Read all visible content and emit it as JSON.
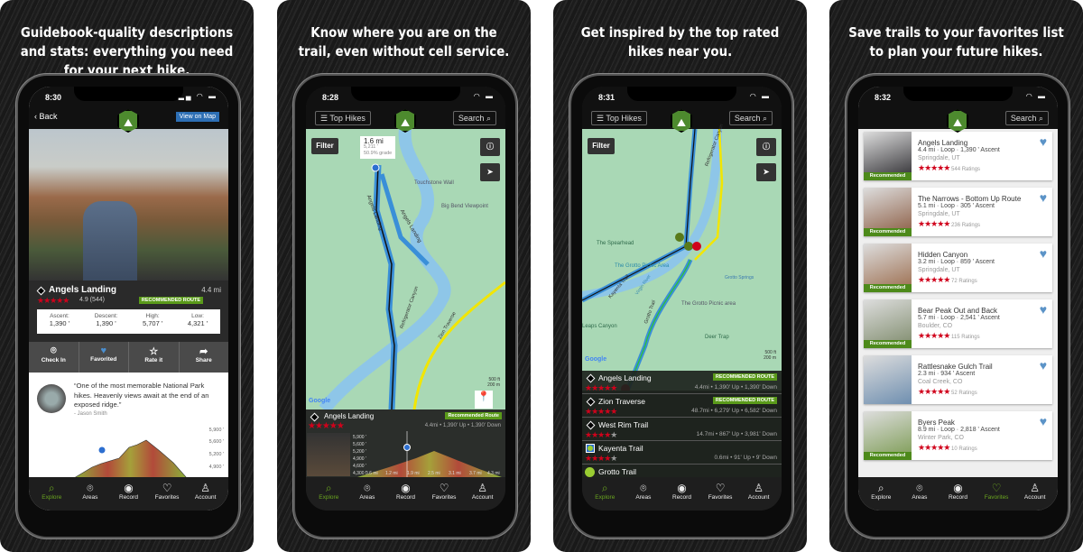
{
  "captions": [
    "Guidebook-quality descriptions and stats: everything you need for your next hike.",
    "Know where you are on the trail, even without cell service.",
    "Get inspired by the top rated hikes near you.",
    "Save trails to your favorites list to plan your future hikes."
  ],
  "status_times": [
    "8:30",
    "8:28",
    "8:31",
    "8:32"
  ],
  "tabs": [
    {
      "label": "Explore",
      "icon": "search"
    },
    {
      "label": "Areas",
      "icon": "pin"
    },
    {
      "label": "Record",
      "icon": "record"
    },
    {
      "label": "Favorites",
      "icon": "heart"
    },
    {
      "label": "Account",
      "icon": "person"
    }
  ],
  "screen1": {
    "back": "Back",
    "view_map": "View on Map",
    "title": "Angels Landing",
    "distance": "4.4 mi",
    "rating": "4.9 (544)",
    "badge": "RECOMMENDED ROUTE",
    "stats": [
      {
        "label": "Ascent:",
        "value": "1,390 '"
      },
      {
        "label": "Descent:",
        "value": "1,390 '"
      },
      {
        "label": "High:",
        "value": "5,707 '"
      },
      {
        "label": "Low:",
        "value": "4,321 '"
      }
    ],
    "actions": [
      {
        "label": "Check In",
        "icon": "pin"
      },
      {
        "label": "Favorited",
        "icon": "heart-filled"
      },
      {
        "label": "Rate it",
        "icon": "star"
      },
      {
        "label": "Share",
        "icon": "share"
      }
    ],
    "quote": "“One of the most memorable National Park hikes. Heavenly views await at the end of an exposed ridge.”",
    "author": "- Jason Smith",
    "elev_ticks": [
      "5,900 '",
      "5,600 '",
      "5,200 '",
      "4,900 '"
    ]
  },
  "screen2": {
    "top_hikes": "Top Hikes",
    "search": "Search",
    "filter": "Filter",
    "tooltip": {
      "dist": "1.6 mi",
      "elev": "5,211 '",
      "grade": "50.9% grade"
    },
    "map_labels": [
      "Touchstone Wall",
      "Big Bend Viewpoint",
      "Angels Landing",
      "Angels Landing",
      "Refrigerator Canyon",
      "Zion Traverse"
    ],
    "scale": [
      "500 ft",
      "200 m"
    ],
    "google": "Google",
    "sheet": {
      "title": "Angels Landing",
      "badge": "Recommended Route",
      "stats": "4.4mi • 1,390' Up • 1,390' Down",
      "y_ticks": [
        "5,900 '",
        "5,600 '",
        "5,200 '",
        "4,900 '",
        "4,600 '",
        "4,300 '"
      ],
      "x_ticks": [
        "0.6 mi",
        "1.2 mi",
        "1.9 mi",
        "2.5 mi",
        "3.1 mi",
        "3.7 mi",
        "4.3 mi"
      ]
    }
  },
  "screen3": {
    "top_hikes": "Top Hikes",
    "search": "Search",
    "filter": "Filter",
    "map_labels": [
      "Refrigerator Canyon",
      "The Spearhead",
      "The Grotto Picnic Area",
      "Grotto Springs",
      "The Grotto Picnic area",
      "Kayenta Trail",
      "Virgin River",
      "Grotto Trail",
      "Deer Trap",
      "Leaps Canyon"
    ],
    "scale": [
      "500 ft",
      "200 m"
    ],
    "google": "Google",
    "trails": [
      {
        "name": "Angels Landing",
        "stats": "4.4mi • 1,390' Up • 1,390' Down",
        "badge": "RECOMMENDED ROUTE",
        "rating": 5,
        "difficulty": "black-diamond"
      },
      {
        "name": "Zion Traverse",
        "stats": "48.7mi • 6,279' Up • 6,582' Down",
        "badge": "RECOMMENDED ROUTE",
        "rating": 5,
        "difficulty": "black-diamond"
      },
      {
        "name": "West Rim Trail",
        "stats": "14.7mi • 867' Up • 3,981' Down",
        "badge": "",
        "rating": 4.5,
        "difficulty": "black-diamond"
      },
      {
        "name": "Kayenta Trail",
        "stats": "0.6mi • 91' Up • 9' Down",
        "badge": "",
        "rating": 4,
        "difficulty": "blue-green"
      },
      {
        "name": "Grotto Trail",
        "stats": "",
        "badge": "",
        "rating": null,
        "difficulty": "green"
      }
    ]
  },
  "screen4": {
    "search": "Search",
    "recommended": "Recommended",
    "favorites": [
      {
        "name": "Angels Landing",
        "meta": "4.4 mi · Loop · 1,390 ' Ascent",
        "location": "Springdale, UT",
        "ratings": "544 Ratings",
        "recommended": true,
        "thumb": "#2b2a2e"
      },
      {
        "name": "The Narrows - Bottom Up Route",
        "meta": "5.1 mi · Loop · 305 ' Ascent",
        "location": "Springdale, UT",
        "ratings": "236 Ratings",
        "recommended": true,
        "thumb": "#8a5a40"
      },
      {
        "name": "Hidden Canyon",
        "meta": "3.2 mi · Loop · 859 ' Ascent",
        "location": "Springdale, UT",
        "ratings": "72 Ratings",
        "recommended": true,
        "thumb": "#9a6a4a"
      },
      {
        "name": "Bear Peak Out and Back",
        "meta": "5.7 mi · Loop · 2,541 ' Ascent",
        "location": "Boulder, CO",
        "ratings": "115 Ratings",
        "recommended": true,
        "thumb": "#7d8a6a"
      },
      {
        "name": "Rattlesnake Gulch Trail",
        "meta": "2.3 mi · 934 ' Ascent",
        "location": "Coal Creek, CO",
        "ratings": "52 Ratings",
        "recommended": false,
        "thumb": "#6f8fb0"
      },
      {
        "name": "Byers Peak",
        "meta": "8.9 mi · Loop · 2,818 ' Ascent",
        "location": "Winter Park, CO",
        "ratings": "10 Ratings",
        "recommended": true,
        "thumb": "#7a9a50"
      }
    ]
  },
  "colors": {
    "accent_green": "#6aa51f",
    "rating_red": "#d0021b",
    "heart_blue": "#5b93c7"
  }
}
